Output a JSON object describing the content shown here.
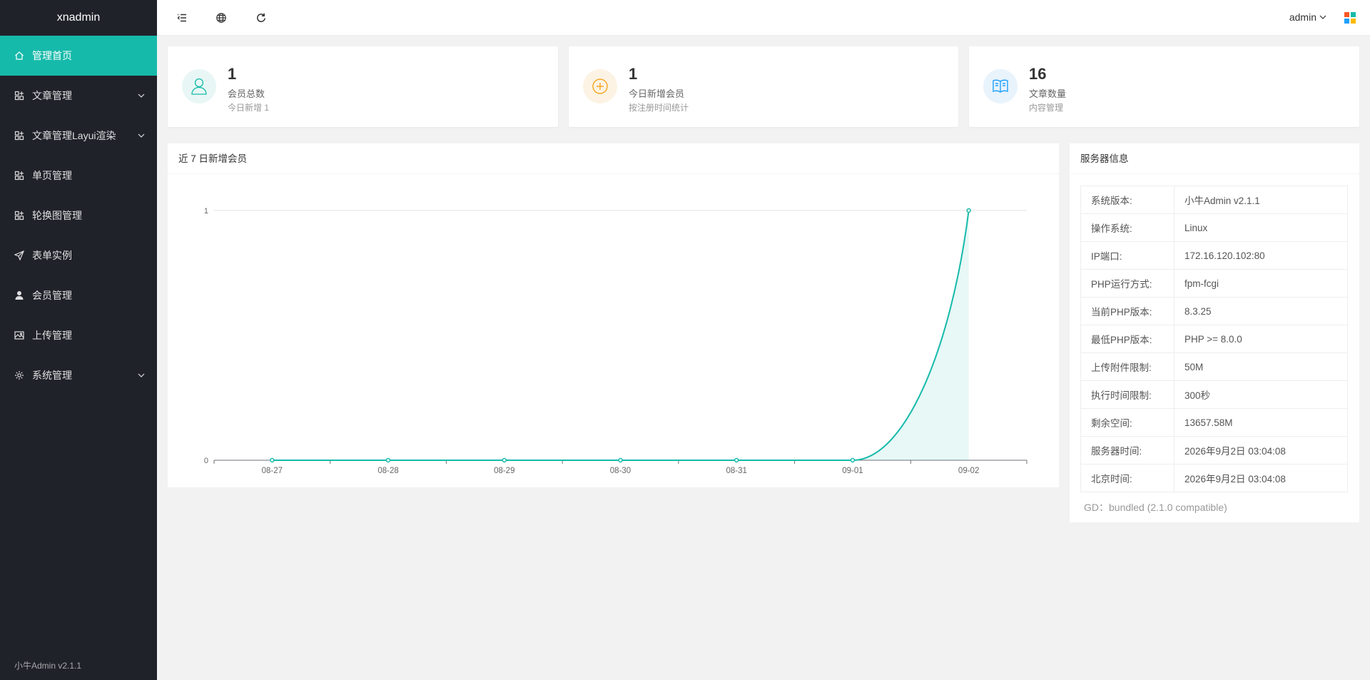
{
  "app": {
    "name": "xnadmin",
    "version_footer": "小牛Admin v2.1.1"
  },
  "sidebar": {
    "items": [
      {
        "label": "管理首页",
        "icon": "home-icon",
        "active": true,
        "expandable": false
      },
      {
        "label": "文章管理",
        "icon": "grid-icon",
        "active": false,
        "expandable": true
      },
      {
        "label": "文章管理Layui渲染",
        "icon": "grid-icon",
        "active": false,
        "expandable": true
      },
      {
        "label": "单页管理",
        "icon": "grid-icon",
        "active": false,
        "expandable": false
      },
      {
        "label": "轮换图管理",
        "icon": "grid-icon",
        "active": false,
        "expandable": false
      },
      {
        "label": "表单实例",
        "icon": "send-icon",
        "active": false,
        "expandable": false
      },
      {
        "label": "会员管理",
        "icon": "user-icon",
        "active": false,
        "expandable": false
      },
      {
        "label": "上传管理",
        "icon": "image-icon",
        "active": false,
        "expandable": false
      },
      {
        "label": "系统管理",
        "icon": "gear-icon",
        "active": false,
        "expandable": true
      }
    ]
  },
  "header": {
    "user": "admin",
    "icons": [
      "menu-toggle-icon",
      "globe-icon",
      "refresh-icon",
      "theme-icon"
    ]
  },
  "stats": [
    {
      "value": "1",
      "label": "会员总数",
      "sub": "今日新增 1",
      "icon": "user-outline-icon",
      "color": "#16baaa",
      "bg": "#e8f7f5"
    },
    {
      "value": "1",
      "label": "今日新增会员",
      "sub": "按注册时间统计",
      "icon": "plus-circle-icon",
      "color": "#f5a623",
      "bg": "#fdf3e4"
    },
    {
      "value": "16",
      "label": "文章数量",
      "sub": "内容管理",
      "icon": "book-icon",
      "color": "#1e9fff",
      "bg": "#e8f3fc"
    }
  ],
  "chart_panel": {
    "title": "近 7 日新增会员"
  },
  "server_panel": {
    "title": "服务器信息",
    "rows": [
      {
        "key": "系统版本:",
        "value": "小牛Admin v2.1.1"
      },
      {
        "key": "操作系统:",
        "value": "Linux"
      },
      {
        "key": "IP端口:",
        "value": "172.16.120.102:80"
      },
      {
        "key": "PHP运行方式:",
        "value": "fpm-fcgi"
      },
      {
        "key": "当前PHP版本:",
        "value": "8.3.25"
      },
      {
        "key": "最低PHP版本:",
        "value": "PHP >= 8.0.0"
      },
      {
        "key": "上传附件限制:",
        "value": "50M"
      },
      {
        "key": "执行时间限制:",
        "value": "300秒"
      },
      {
        "key": "剩余空间:",
        "value": "13657.58M"
      },
      {
        "key": "服务器时间:",
        "value": "2026年9月2日 03:04:08"
      },
      {
        "key": "北京时间:",
        "value": "2026年9月2日 03:04:08"
      }
    ],
    "gd": "GD：bundled (2.1.0 compatible)"
  },
  "chart_data": {
    "type": "line",
    "categories": [
      "08-27",
      "08-28",
      "08-29",
      "08-30",
      "08-31",
      "09-01",
      "09-02"
    ],
    "values": [
      0,
      0,
      0,
      0,
      0,
      0,
      1
    ],
    "ylim": [
      0,
      1
    ],
    "yticks": [
      "0",
      "1"
    ],
    "smooth": true,
    "area": true,
    "color": "#16baaa",
    "grid": true
  }
}
